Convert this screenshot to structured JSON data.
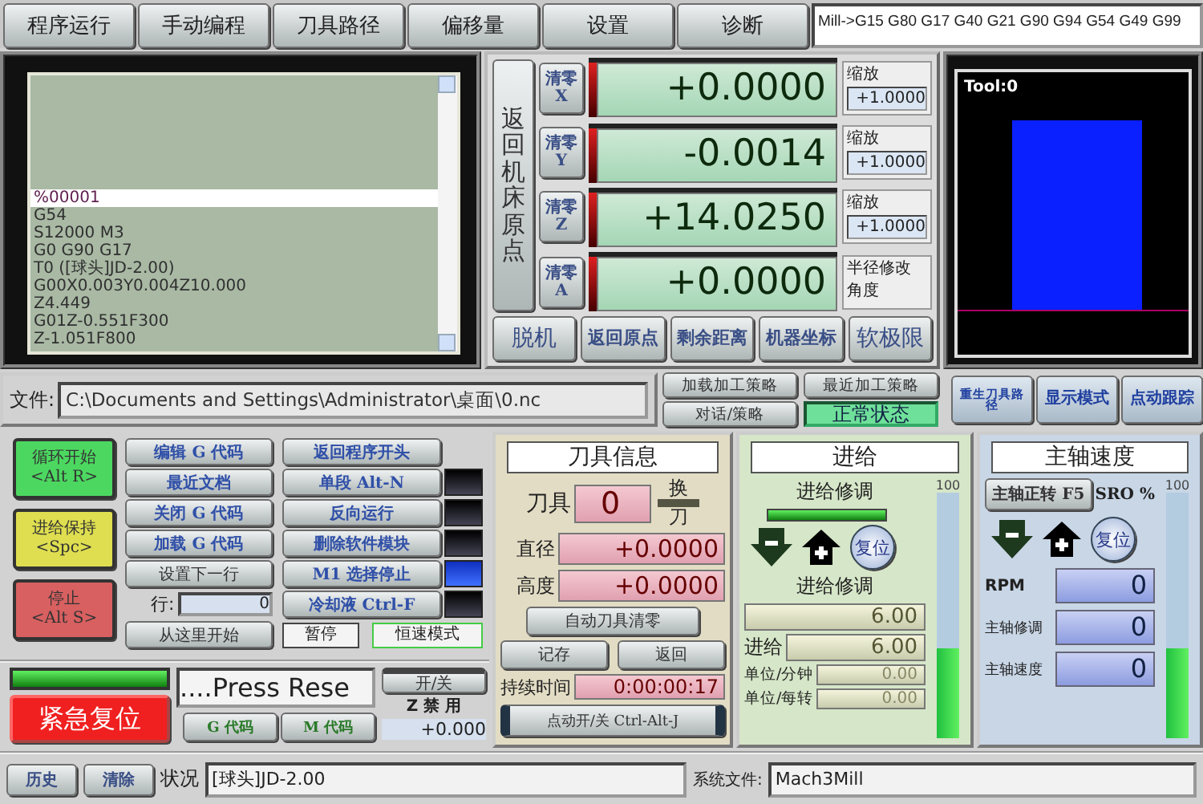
{
  "tabs": [
    "程序运行",
    "手动编程",
    "刀具路径",
    "偏移量",
    "设置",
    "诊断"
  ],
  "modal_line": "Mill->G15  G80 G17 G40 G21 G90 G94 G54 G49 G99",
  "gcode_lines": [
    {
      "text": "%00001",
      "selected": true
    },
    {
      "text": "G54",
      "selected": false
    },
    {
      "text": "S12000 M3",
      "selected": false
    },
    {
      "text": "G0 G90 G17",
      "selected": false
    },
    {
      "text": "T0 ([球头]JD-2.00)",
      "selected": false
    },
    {
      "text": "G00X0.003Y0.004Z10.000",
      "selected": false
    },
    {
      "text": "Z4.449",
      "selected": false
    },
    {
      "text": "G01Z-0.551F300",
      "selected": false
    },
    {
      "text": "Z-1.051F800",
      "selected": false
    }
  ],
  "dro": {
    "ref_all_button": "返回机床原点",
    "axes": [
      {
        "zero_button": "清零",
        "axis": "X",
        "value": "+0.0000",
        "scale_label": "缩放",
        "scale": "+1.0000"
      },
      {
        "zero_button": "清零",
        "axis": "Y",
        "value": "-0.0014",
        "scale_label": "缩放",
        "scale": "+1.0000"
      },
      {
        "zero_button": "清零",
        "axis": "Z",
        "value": "+14.0250",
        "scale_label": "缩放",
        "scale": "+1.0000"
      },
      {
        "zero_button": "清零",
        "axis": "A",
        "value": "+0.0000",
        "side_labels": [
          "半径修改",
          "角度"
        ]
      }
    ],
    "buttons": [
      "脱机",
      "返回原点",
      "剩余距离",
      "机器坐标",
      "软极限"
    ]
  },
  "toolpath": {
    "label": "Tool:0"
  },
  "file": {
    "label": "文件:",
    "path": "C:\\Documents and Settings\\Administrator\\桌面\\0.nc"
  },
  "strategy_buttons": [
    "加载加工策略",
    "最近加工策略",
    "对话/策略"
  ],
  "machine_state": "正常状态",
  "view_buttons": [
    "重生刀具路径",
    "显示模式",
    "点动跟踪"
  ],
  "cycle_buttons": [
    {
      "label": "循环开始",
      "shortcut": "<Alt R>",
      "color": "#4cd860"
    },
    {
      "label": "进给保持",
      "shortcut": "<Spc>",
      "color": "#dede50"
    },
    {
      "label": "停止",
      "shortcut": "<Alt S>",
      "color": "#d86060"
    }
  ],
  "gcode_buttons": [
    "编辑 G 代码",
    "最近文档",
    "关闭 G 代码",
    "加载 G 代码",
    "设置下一行"
  ],
  "line_label": "行:",
  "line_value": "0",
  "run_from_here": "从这里开始",
  "program_buttons": [
    {
      "label": "返回程序开头",
      "kind": "plain"
    },
    {
      "label": "单段 Alt-N",
      "kind": "toggle",
      "on": false
    },
    {
      "label": "反向运行",
      "kind": "toggle",
      "on": false
    },
    {
      "label": "删除软件模块",
      "kind": "toggle",
      "on": false
    },
    {
      "label": "M1 选择停止",
      "kind": "toggle",
      "on": true
    },
    {
      "label": "冷却液 Ctrl-F",
      "kind": "toggle",
      "on": false
    }
  ],
  "pause_label": "暂停",
  "css_label": "恒速模式",
  "emergency": {
    "reset_button": "紧急复位",
    "message": "....Press Rese",
    "gcode_button": "G 代码",
    "mcode_button": "M 代码",
    "onoff_button": "开/关",
    "z_inhibit_label": "Z 禁 用",
    "z_value": "+0.000"
  },
  "tool_info": {
    "title": "刀具信息",
    "tool_label": "刀具",
    "tool": "0",
    "change_top": "换",
    "change_bottom": "刀",
    "diameter_label": "直径",
    "diameter": "+0.0000",
    "height_label": "高度",
    "height": "+0.0000",
    "auto_zero_button": "自动刀具清零",
    "save_button": "记存",
    "return_button": "返回",
    "elapsed_label": "持续时间",
    "elapsed": "0:00:00:17",
    "jog_button": "点动开/关 Ctrl-Alt-J"
  },
  "feed": {
    "title": "进给",
    "override_label": "进给修调",
    "reset_button": "复位",
    "override_label_2": "进给修调",
    "override": "6.00",
    "feed_label": "进给",
    "feed": "6.00",
    "per_min_label": "单位/分钟",
    "per_min": "0.00",
    "per_rev_label": "单位/每转",
    "per_rev": "0.00",
    "slider_max": "100",
    "slider": {
      "level": 0.37
    }
  },
  "spindle": {
    "title": "主轴速度",
    "cw_button": "主轴正转 F5",
    "sro_label": "SRO %",
    "slider_max": "100",
    "reset_button": "复位",
    "rpm_label": "RPM",
    "rpm": "0",
    "override_label": "主轴修调",
    "override": "0",
    "speed_label": "主轴速度",
    "speed": "0",
    "slider": {
      "level": 0.37
    }
  },
  "status_bar": {
    "history_button": "历史",
    "clear_button": "清除",
    "status_label": "状况",
    "status": "[球头]JD-2.00",
    "profile_label": "系统文件:",
    "profile": "Mach3Mill"
  }
}
